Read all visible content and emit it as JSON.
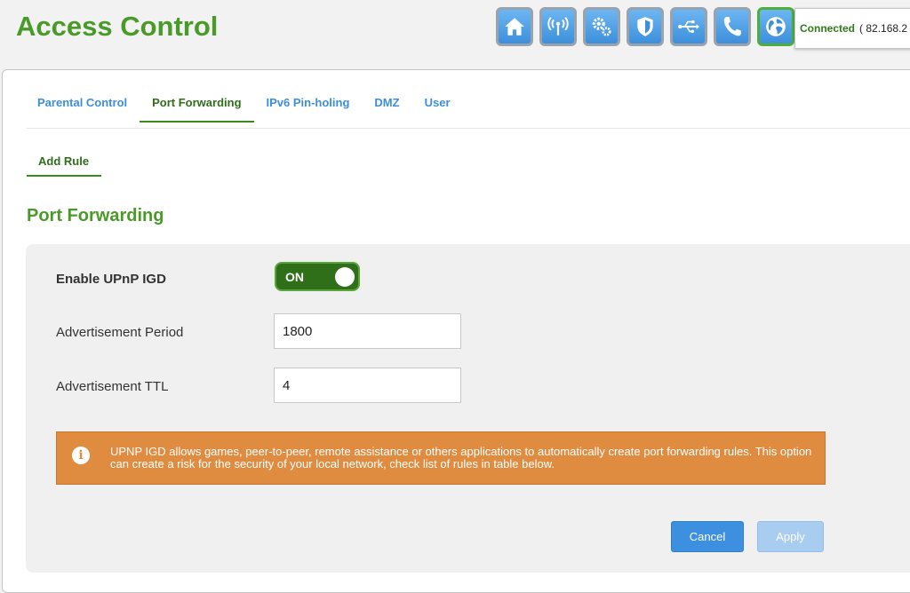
{
  "header": {
    "title": "Access Control",
    "status": "Connected",
    "ip": "( 82.168.2"
  },
  "nav_icons": [
    {
      "name": "home-icon",
      "active": false
    },
    {
      "name": "wireless-icon",
      "active": false
    },
    {
      "name": "settings-icon",
      "active": false
    },
    {
      "name": "shield-icon",
      "active": false
    },
    {
      "name": "usb-icon",
      "active": false
    },
    {
      "name": "phone-icon",
      "active": false
    },
    {
      "name": "globe-icon",
      "active": true
    }
  ],
  "tabs": [
    {
      "label": "Parental Control",
      "active": false
    },
    {
      "label": "Port Forwarding",
      "active": true
    },
    {
      "label": "IPv6 Pin-holing",
      "active": false
    },
    {
      "label": "DMZ",
      "active": false
    },
    {
      "label": "User",
      "active": false
    }
  ],
  "subtabs": [
    {
      "label": "Add Rule",
      "active": true
    }
  ],
  "section_title": "Port Forwarding",
  "form": {
    "upnp_label": "Enable UPnP IGD",
    "upnp_toggle": "ON",
    "period_label": "Advertisement Period",
    "period_value": "1800",
    "ttl_label": "Advertisement TTL",
    "ttl_value": "4"
  },
  "info": {
    "icon": "info-icon",
    "text": "UPNP IGD allows games, peer-to-peer, remote assistance or others applications to automatically create port forwarding rules. This option can create a risk for the security of your local network, check list of rules in table below."
  },
  "buttons": {
    "cancel": "Cancel",
    "apply": "Apply"
  },
  "colors": {
    "brand_green": "#4a9a2a",
    "link_blue": "#3d8fdb",
    "warning_orange": "#e08c40",
    "toggle_green": "#2f6f1a"
  }
}
